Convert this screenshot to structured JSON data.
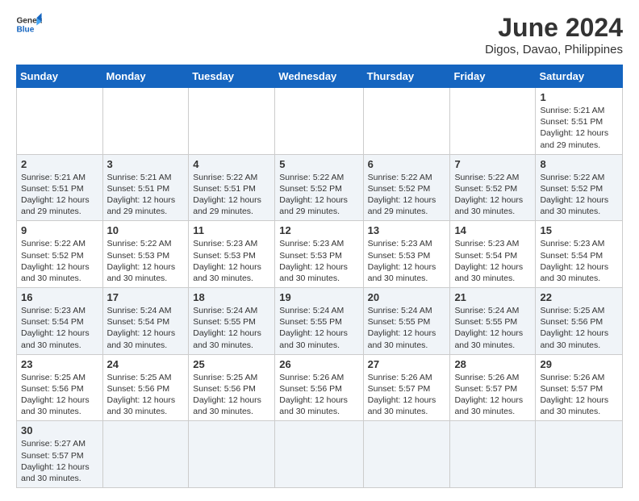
{
  "header": {
    "logo_general": "General",
    "logo_blue": "Blue",
    "title": "June 2024",
    "subtitle": "Digos, Davao, Philippines"
  },
  "weekdays": [
    "Sunday",
    "Monday",
    "Tuesday",
    "Wednesday",
    "Thursday",
    "Friday",
    "Saturday"
  ],
  "weeks": [
    [
      {
        "day": "",
        "info": ""
      },
      {
        "day": "",
        "info": ""
      },
      {
        "day": "",
        "info": ""
      },
      {
        "day": "",
        "info": ""
      },
      {
        "day": "",
        "info": ""
      },
      {
        "day": "",
        "info": ""
      },
      {
        "day": "1",
        "info": "Sunrise: 5:21 AM\nSunset: 5:51 PM\nDaylight: 12 hours and 29 minutes."
      }
    ],
    [
      {
        "day": "2",
        "info": "Sunrise: 5:21 AM\nSunset: 5:51 PM\nDaylight: 12 hours and 29 minutes."
      },
      {
        "day": "3",
        "info": "Sunrise: 5:21 AM\nSunset: 5:51 PM\nDaylight: 12 hours and 29 minutes."
      },
      {
        "day": "4",
        "info": "Sunrise: 5:22 AM\nSunset: 5:51 PM\nDaylight: 12 hours and 29 minutes."
      },
      {
        "day": "5",
        "info": "Sunrise: 5:22 AM\nSunset: 5:52 PM\nDaylight: 12 hours and 29 minutes."
      },
      {
        "day": "6",
        "info": "Sunrise: 5:22 AM\nSunset: 5:52 PM\nDaylight: 12 hours and 29 minutes."
      },
      {
        "day": "7",
        "info": "Sunrise: 5:22 AM\nSunset: 5:52 PM\nDaylight: 12 hours and 30 minutes."
      },
      {
        "day": "8",
        "info": "Sunrise: 5:22 AM\nSunset: 5:52 PM\nDaylight: 12 hours and 30 minutes."
      }
    ],
    [
      {
        "day": "9",
        "info": "Sunrise: 5:22 AM\nSunset: 5:52 PM\nDaylight: 12 hours and 30 minutes."
      },
      {
        "day": "10",
        "info": "Sunrise: 5:22 AM\nSunset: 5:53 PM\nDaylight: 12 hours and 30 minutes."
      },
      {
        "day": "11",
        "info": "Sunrise: 5:23 AM\nSunset: 5:53 PM\nDaylight: 12 hours and 30 minutes."
      },
      {
        "day": "12",
        "info": "Sunrise: 5:23 AM\nSunset: 5:53 PM\nDaylight: 12 hours and 30 minutes."
      },
      {
        "day": "13",
        "info": "Sunrise: 5:23 AM\nSunset: 5:53 PM\nDaylight: 12 hours and 30 minutes."
      },
      {
        "day": "14",
        "info": "Sunrise: 5:23 AM\nSunset: 5:54 PM\nDaylight: 12 hours and 30 minutes."
      },
      {
        "day": "15",
        "info": "Sunrise: 5:23 AM\nSunset: 5:54 PM\nDaylight: 12 hours and 30 minutes."
      }
    ],
    [
      {
        "day": "16",
        "info": "Sunrise: 5:23 AM\nSunset: 5:54 PM\nDaylight: 12 hours and 30 minutes."
      },
      {
        "day": "17",
        "info": "Sunrise: 5:24 AM\nSunset: 5:54 PM\nDaylight: 12 hours and 30 minutes."
      },
      {
        "day": "18",
        "info": "Sunrise: 5:24 AM\nSunset: 5:55 PM\nDaylight: 12 hours and 30 minutes."
      },
      {
        "day": "19",
        "info": "Sunrise: 5:24 AM\nSunset: 5:55 PM\nDaylight: 12 hours and 30 minutes."
      },
      {
        "day": "20",
        "info": "Sunrise: 5:24 AM\nSunset: 5:55 PM\nDaylight: 12 hours and 30 minutes."
      },
      {
        "day": "21",
        "info": "Sunrise: 5:24 AM\nSunset: 5:55 PM\nDaylight: 12 hours and 30 minutes."
      },
      {
        "day": "22",
        "info": "Sunrise: 5:25 AM\nSunset: 5:56 PM\nDaylight: 12 hours and 30 minutes."
      }
    ],
    [
      {
        "day": "23",
        "info": "Sunrise: 5:25 AM\nSunset: 5:56 PM\nDaylight: 12 hours and 30 minutes."
      },
      {
        "day": "24",
        "info": "Sunrise: 5:25 AM\nSunset: 5:56 PM\nDaylight: 12 hours and 30 minutes."
      },
      {
        "day": "25",
        "info": "Sunrise: 5:25 AM\nSunset: 5:56 PM\nDaylight: 12 hours and 30 minutes."
      },
      {
        "day": "26",
        "info": "Sunrise: 5:26 AM\nSunset: 5:56 PM\nDaylight: 12 hours and 30 minutes."
      },
      {
        "day": "27",
        "info": "Sunrise: 5:26 AM\nSunset: 5:57 PM\nDaylight: 12 hours and 30 minutes."
      },
      {
        "day": "28",
        "info": "Sunrise: 5:26 AM\nSunset: 5:57 PM\nDaylight: 12 hours and 30 minutes."
      },
      {
        "day": "29",
        "info": "Sunrise: 5:26 AM\nSunset: 5:57 PM\nDaylight: 12 hours and 30 minutes."
      }
    ],
    [
      {
        "day": "30",
        "info": "Sunrise: 5:27 AM\nSunset: 5:57 PM\nDaylight: 12 hours and 30 minutes."
      },
      {
        "day": "",
        "info": ""
      },
      {
        "day": "",
        "info": ""
      },
      {
        "day": "",
        "info": ""
      },
      {
        "day": "",
        "info": ""
      },
      {
        "day": "",
        "info": ""
      },
      {
        "day": "",
        "info": ""
      }
    ]
  ]
}
